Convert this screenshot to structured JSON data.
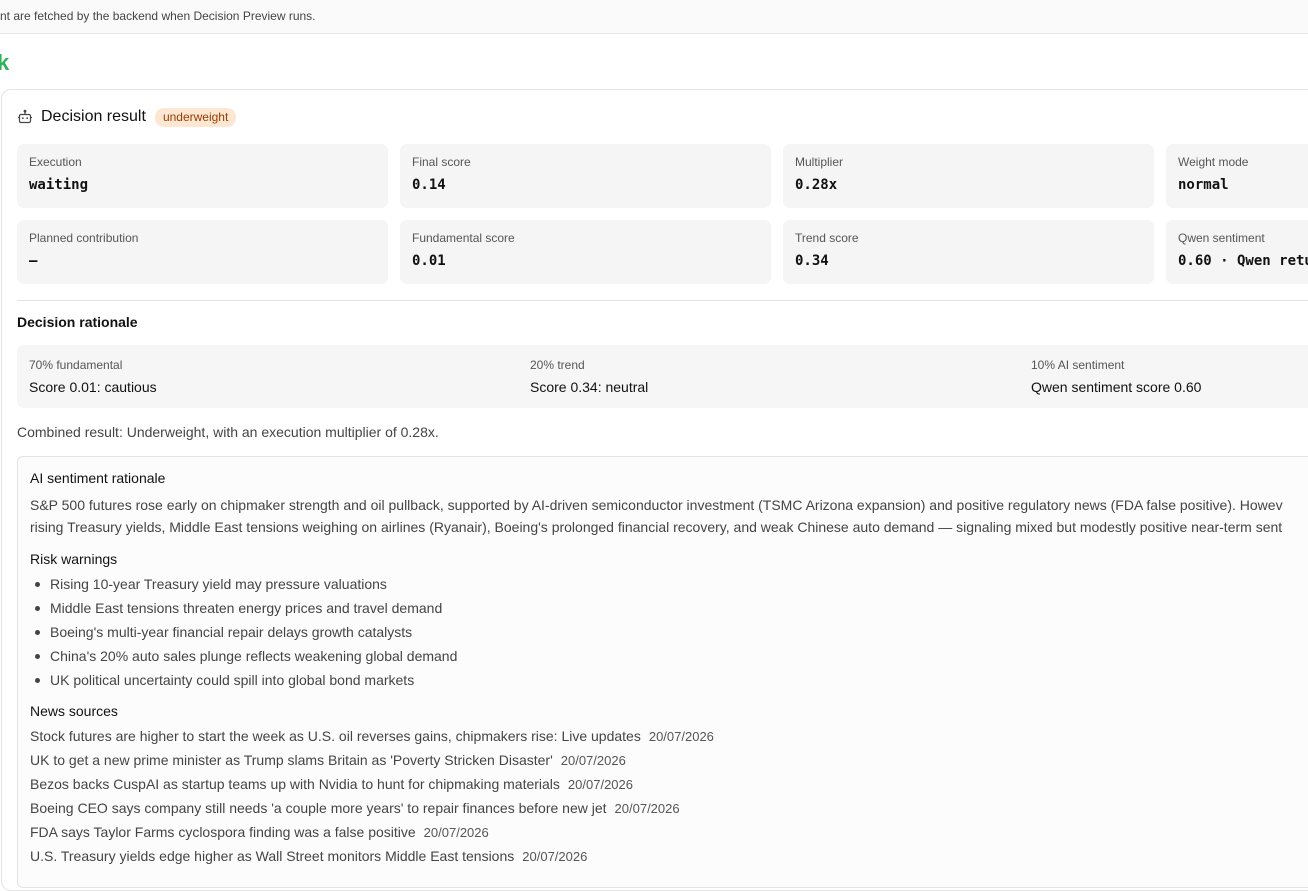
{
  "top_note": "nt are fetched by the backend when Decision Preview runs.",
  "heading_fragment": "k",
  "decision": {
    "title": "Decision result",
    "badge": "underweight",
    "metrics": [
      {
        "label": "Execution",
        "value": "waiting"
      },
      {
        "label": "Final score",
        "value": "0.14"
      },
      {
        "label": "Multiplier",
        "value": "0.28x"
      },
      {
        "label": "Weight mode",
        "value": "normal"
      },
      {
        "label": "Planned contribution",
        "value": "–"
      },
      {
        "label": "Fundamental score",
        "value": "0.01"
      },
      {
        "label": "Trend score",
        "value": "0.34"
      },
      {
        "label": "Qwen sentiment",
        "value": "0.60 · Qwen retu"
      }
    ]
  },
  "rationale": {
    "title": "Decision rationale",
    "weights": [
      {
        "label": "70% fundamental",
        "value": "Score 0.01: cautious"
      },
      {
        "label": "20% trend",
        "value": "Score 0.34: neutral"
      },
      {
        "label": "10% AI sentiment",
        "value": "Qwen sentiment score 0.60"
      }
    ],
    "combined": "Combined result: Underweight, with an execution multiplier of 0.28x."
  },
  "ai": {
    "title": "AI sentiment rationale",
    "text_line1": "S&P 500 futures rose early on chipmaker strength and oil pullback, supported by AI-driven semiconductor investment (TSMC Arizona expansion) and positive regulatory news (FDA false positive). Howev",
    "text_line2": "rising Treasury yields, Middle East tensions weighing on airlines (Ryanair), Boeing's prolonged financial recovery, and weak Chinese auto demand — signaling mixed but modestly positive near-term sent",
    "risk_title": "Risk warnings",
    "risks": [
      "Rising 10-year Treasury yield may pressure valuations",
      "Middle East tensions threaten energy prices and travel demand",
      "Boeing's multi-year financial repair delays growth catalysts",
      "China's 20% auto sales plunge reflects weakening global demand",
      "UK political uncertainty could spill into global bond markets"
    ],
    "news_title": "News sources",
    "news": [
      {
        "title": "Stock futures are higher to start the week as U.S. oil reverses gains, chipmakers rise: Live updates",
        "date": "20/07/2026"
      },
      {
        "title": "UK to get a new prime minister as Trump slams Britain as 'Poverty Stricken Disaster'",
        "date": "20/07/2026"
      },
      {
        "title": "Bezos backs CuspAI as startup teams up with Nvidia to hunt for chipmaking materials",
        "date": "20/07/2026"
      },
      {
        "title": "Boeing CEO says company still needs 'a couple more years' to repair finances before new jet",
        "date": "20/07/2026"
      },
      {
        "title": "FDA says Taylor Farms cyclospora finding was a false positive",
        "date": "20/07/2026"
      },
      {
        "title": "U.S. Treasury yields edge higher as Wall Street monitors Middle East tensions",
        "date": "20/07/2026"
      }
    ]
  }
}
